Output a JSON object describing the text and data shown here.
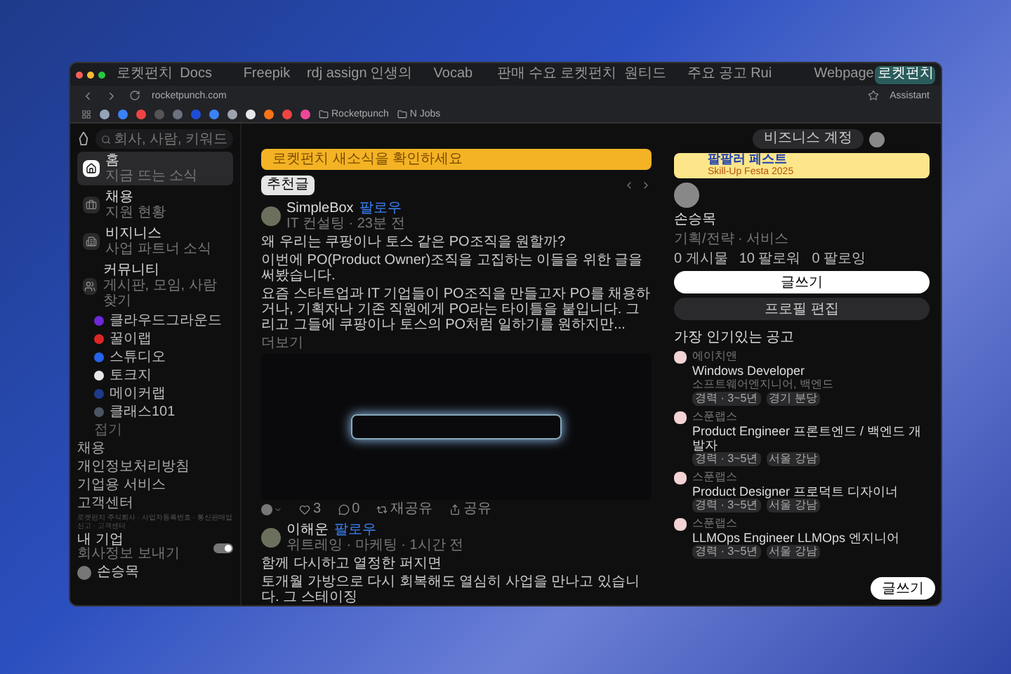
{
  "browser": {
    "tabs": [
      {
        "title": "로켓펀치",
        "selected": false
      },
      {
        "title": "Docs",
        "selected": false
      },
      {
        "title": "Freepik",
        "selected": false
      },
      {
        "title": "rdj assign",
        "selected": false
      },
      {
        "title": "인생의",
        "selected": false
      },
      {
        "title": "Vocab",
        "selected": false
      },
      {
        "title": "판매 수요",
        "selected": false
      },
      {
        "title": "로켓펀치",
        "selected": false
      },
      {
        "title": "원티드",
        "selected": false
      },
      {
        "title": "주요 공고",
        "selected": false
      },
      {
        "title": "Rui",
        "selected": false
      },
      {
        "title": "Webpage",
        "selected": false
      },
      {
        "title": "로켓펀치",
        "selected": true
      }
    ],
    "address": "rocketpunch.com",
    "assistant": "Assistant",
    "bookmark_folders": [
      "Rocketpunch",
      "N Jobs"
    ]
  },
  "sidebar": {
    "search_placeholder": "회사, 사람, 키워드",
    "nav": [
      {
        "label": "홈",
        "sub": "지금 뜨는 소식",
        "selected": true
      },
      {
        "label": "채용",
        "sub": "지원 현황",
        "selected": false
      },
      {
        "label": "비지니스",
        "sub": "사업 파트너 소식",
        "selected": false
      },
      {
        "label": "커뮤니티",
        "sub": "게시판, 모임, 사람 찾기",
        "selected": false
      }
    ],
    "communities": [
      {
        "name": "클라우드그라운드",
        "color": "#6d28d9"
      },
      {
        "name": "꿀이랩",
        "color": "#dc2626"
      },
      {
        "name": "스튜디오",
        "color": "#2563eb"
      },
      {
        "name": "토크지",
        "color": "#e5e7eb"
      },
      {
        "name": "메이커랩",
        "color": "#1e3a8a"
      },
      {
        "name": "클래스101",
        "color": "#4b5563"
      }
    ],
    "collapse": "접기",
    "links": [
      "채용",
      "개인정보처리방침",
      "기업용 서비스",
      "고객센터"
    ],
    "footer": "로켓펀치 주식회사 · 사업자등록번호 · 통신판매업신고 · 고객센터",
    "company": {
      "title": "내 기업",
      "sub": "회사정보 보내기",
      "on": true
    },
    "user": "손승목"
  },
  "feed": {
    "banner": "로켓펀치 새소식을 확인하세요",
    "recommend": "추천글",
    "posts": [
      {
        "author": "SimpleBox",
        "badge": "팔로우",
        "meta": "IT 컨설팅 · 23분 전",
        "lines": [
          "왜 우리는 쿠팡이나 토스 같은 PO조직을 원할까?",
          "이번에 PO(Product Owner)조직을 고집하는 이들을 위한 글을 써봤습니다.",
          "요즘 스타트업과 IT 기업들이 PO조직을 만들고자 PO를 채용하거나, 기획자나 기존 직원에게 PO라는 타이틀을 붙입니다. 그리고 그들에 쿠팡이나 토스의 PO처럼 일하기를 원하지만..."
        ],
        "more": "더보기",
        "has_photo": true,
        "likes": "3",
        "comments": "0",
        "reshare": "재공유",
        "share": "공유"
      },
      {
        "author": "이해운",
        "badge": "팔로우",
        "meta": "위트레잉 · 마케팅 · 1시간 전",
        "lines": [
          "함께 다시하고 열정한 퍼지면",
          "토개월 가방으로 다시 회복해도 열심히 사업을 만나고 있습니다. 그 스테이징"
        ]
      }
    ]
  },
  "right": {
    "business": "비즈니스 계정",
    "ad": {
      "title": "팔팔러 페스트",
      "sub": "Skill-Up Festa 2025"
    },
    "profile": {
      "name": "손승목",
      "sub": "기획/전략 · 서비스",
      "stats": [
        "0 게시물",
        "10 팔로워",
        "0 팔로잉"
      ],
      "write": "글쓰기",
      "edit": "프로필 편집"
    },
    "jobs_title": "가장 인기있는 공고",
    "jobs": [
      {
        "company": "에이치앤",
        "title": "Windows Developer",
        "sub": "소프트웨어엔지니어, 백엔드",
        "tags": [
          "경력 · 3~5년",
          "경기 분당"
        ]
      },
      {
        "company": "스푼랩스",
        "title": "Product Engineer 프론트엔드 / 백엔드 개발자",
        "tags": [
          "경력 · 3~5년",
          "서울 강남"
        ]
      },
      {
        "company": "스푼랩스",
        "title": "Product Designer 프로덕트 디자이너",
        "tags": [
          "경력 · 3~5년",
          "서울 강남"
        ]
      },
      {
        "company": "스푼랩스",
        "title": "LLMOps Engineer LLMOps 엔지니어",
        "tags": [
          "경력 · 3~5년",
          "서울 강남"
        ]
      }
    ],
    "fab": "글쓰기"
  }
}
